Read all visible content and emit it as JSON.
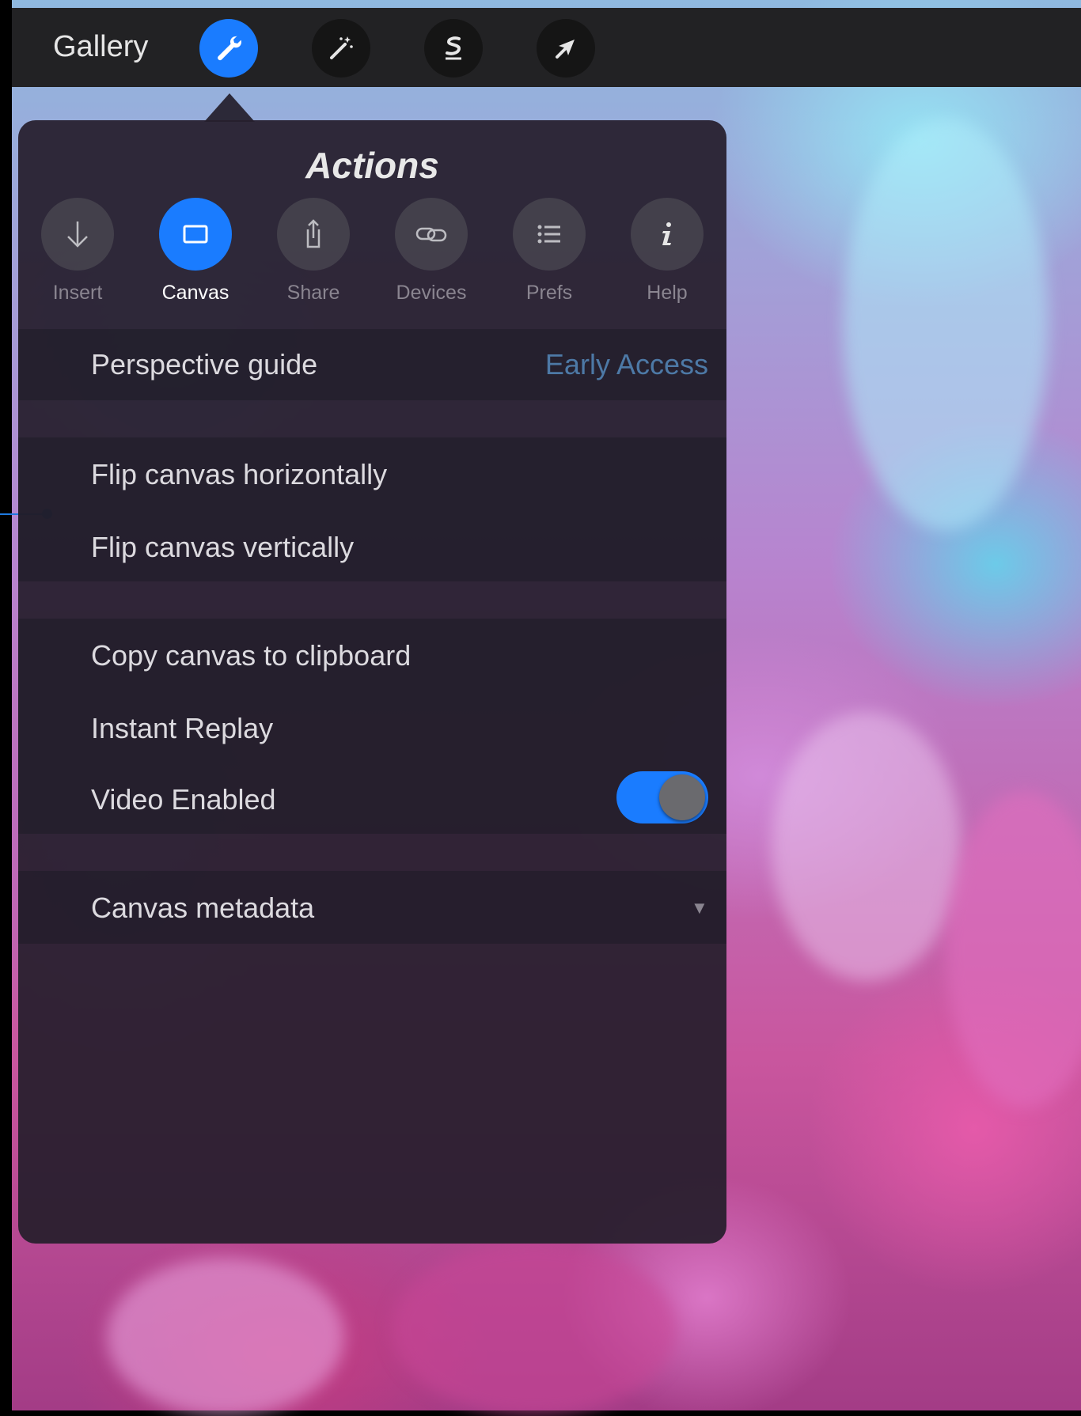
{
  "toolbar": {
    "gallery_label": "Gallery",
    "buttons": [
      {
        "icon": "wrench-icon",
        "active": true
      },
      {
        "icon": "magic-wand-icon",
        "active": false
      },
      {
        "icon": "selection-icon",
        "active": false
      },
      {
        "icon": "transform-arrow-icon",
        "active": false
      }
    ]
  },
  "actions": {
    "title": "Actions",
    "tabs": [
      {
        "label": "Insert",
        "icon": "arrow-down-icon"
      },
      {
        "label": "Canvas",
        "icon": "canvas-icon",
        "active": true
      },
      {
        "label": "Share",
        "icon": "share-icon"
      },
      {
        "label": "Devices",
        "icon": "link-icon"
      },
      {
        "label": "Prefs",
        "icon": "list-icon"
      },
      {
        "label": "Help",
        "icon": "info-icon"
      }
    ],
    "perspective_guide": {
      "label": "Perspective guide",
      "badge": "Early Access"
    },
    "flip_horizontal": "Flip canvas horizontally",
    "flip_vertical": "Flip canvas vertically",
    "copy_clipboard": "Copy canvas to clipboard",
    "instant_replay": "Instant Replay",
    "video_enabled": {
      "label": "Video Enabled",
      "on": true
    },
    "canvas_metadata": "Canvas metadata"
  },
  "colors": {
    "accent": "#1a7cff",
    "early_access": "#4d79a6"
  }
}
